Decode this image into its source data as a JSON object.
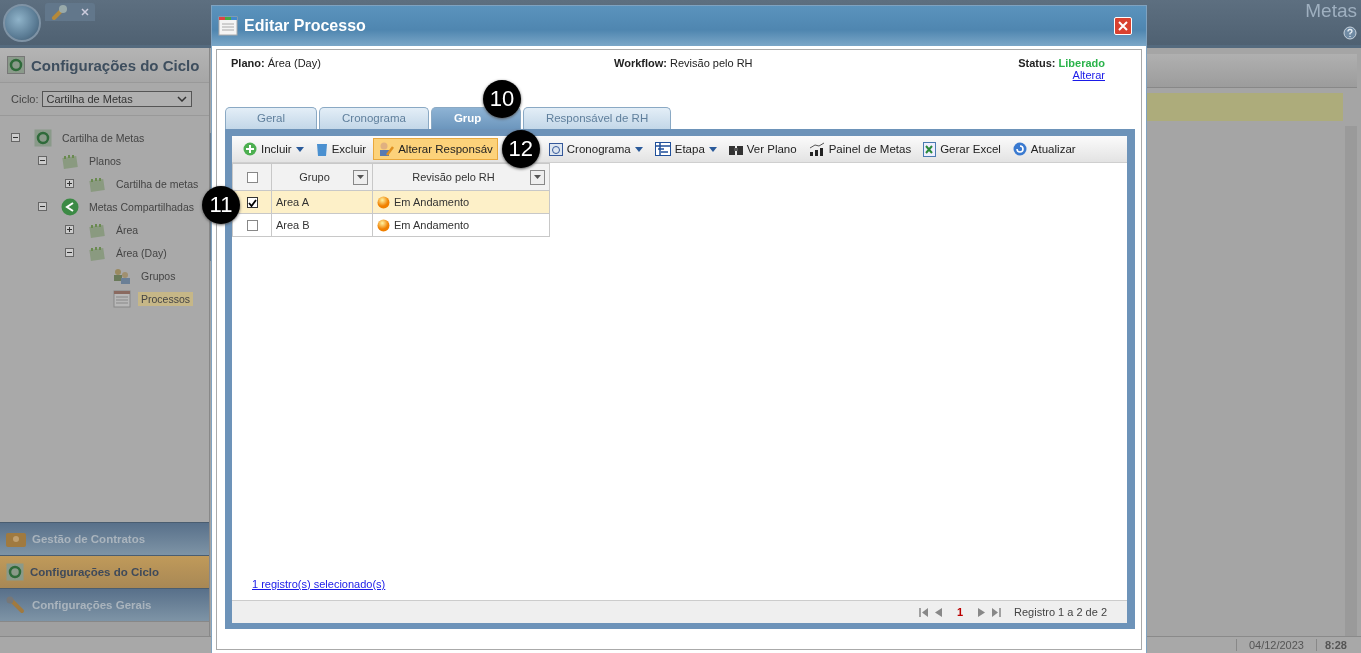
{
  "app": {
    "title": "Metas",
    "date": "04/12/2023",
    "time": "8:28"
  },
  "sidebar": {
    "title": "Configurações do Ciclo",
    "ciclo_label": "Ciclo:",
    "ciclo_value": "Cartilha de Metas",
    "tree": [
      {
        "label": "Cartilha de Metas",
        "expanded": true,
        "selected": false,
        "children": [
          {
            "label": "Planos",
            "expanded": true,
            "selected": false,
            "children": [
              {
                "label": "Cartilha de metas",
                "expanded": false,
                "selected": false
              }
            ]
          },
          {
            "label": "Metas Compartilhadas",
            "expanded": true,
            "selected": false,
            "children": [
              {
                "label": "Área",
                "expanded": false,
                "selected": false
              },
              {
                "label": "Área (Day)",
                "expanded": true,
                "selected": false,
                "children": [
                  {
                    "label": "Grupos",
                    "selected": false
                  },
                  {
                    "label": "Processos",
                    "selected": true
                  }
                ]
              }
            ]
          }
        ]
      }
    ],
    "nav": [
      {
        "label": "Gestão de Contratos",
        "selected": false
      },
      {
        "label": "Configurações do Ciclo",
        "selected": true
      },
      {
        "label": "Configurações Gerais",
        "selected": false
      }
    ]
  },
  "dialog": {
    "title": "Editar Processo",
    "plano_label": "Plano:",
    "plano": "Área (Day)",
    "workflow_label": "Workflow:",
    "workflow": "Revisão pelo RH",
    "status_label": "Status:",
    "status": "Liberado",
    "change_link": "Alterar",
    "tabs": [
      {
        "label": "Geral",
        "selected": false
      },
      {
        "label": "Cronograma",
        "selected": false
      },
      {
        "label": "Grup",
        "selected": true
      },
      {
        "label": "Responsável de RH",
        "selected": false
      }
    ],
    "toolbar": [
      {
        "label": "Incluir",
        "dropdown": true,
        "highlighted": false
      },
      {
        "label": "Excluir",
        "dropdown": false,
        "highlighted": false
      },
      {
        "label": "Alterar Responsáv",
        "dropdown": false,
        "highlighted": true
      },
      {
        "label": "Cronograma",
        "dropdown": true,
        "highlighted": false
      },
      {
        "label": "Etapa",
        "dropdown": true,
        "highlighted": false
      },
      {
        "label": "Ver Plano",
        "dropdown": false,
        "highlighted": false
      },
      {
        "label": "Painel de Metas",
        "dropdown": false,
        "highlighted": false
      },
      {
        "label": "Gerar Excel",
        "dropdown": false,
        "highlighted": false
      },
      {
        "label": "Atualizar",
        "dropdown": false,
        "highlighted": false
      }
    ],
    "table": {
      "all_checked": false,
      "columns": [
        "Grupo",
        "Revisão pelo RH"
      ],
      "rows": [
        {
          "grupo": "Area A",
          "status": "Em Andamento",
          "checked": true,
          "selected": true
        },
        {
          "grupo": "Area B",
          "status": "Em Andamento",
          "checked": false,
          "selected": false
        }
      ]
    },
    "selection_link": "1 registro(s) selecionado(s)",
    "page": "1",
    "records": "Registro 1 a 2 de 2"
  },
  "annotations": [
    "10",
    "11",
    "12"
  ]
}
